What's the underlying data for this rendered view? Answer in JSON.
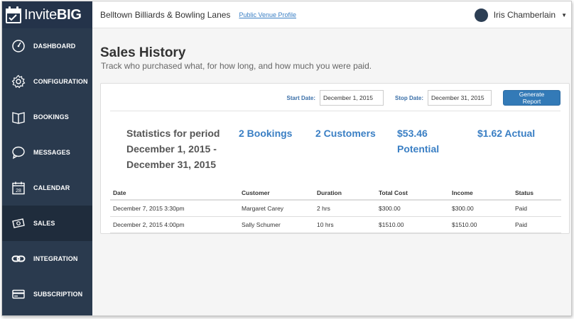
{
  "brand": {
    "name_light": "Invite",
    "name_bold": "BIG"
  },
  "sidebar": {
    "items": [
      {
        "label": "DASHBOARD",
        "icon": "dashboard-gauge-icon"
      },
      {
        "label": "CONFIGURATION",
        "icon": "gear-icon"
      },
      {
        "label": "BOOKINGS",
        "icon": "book-icon"
      },
      {
        "label": "MESSAGES",
        "icon": "speech-bubble-icon"
      },
      {
        "label": "CALENDAR",
        "icon": "calendar-icon"
      },
      {
        "label": "SALES",
        "icon": "money-icon"
      },
      {
        "label": "INTEGRATION",
        "icon": "link-icon"
      },
      {
        "label": "SUBSCRIPTION",
        "icon": "credit-card-icon"
      }
    ],
    "active": "SALES"
  },
  "topbar": {
    "venue_name": "Belltown Billiards & Bowling Lanes",
    "profile_link": "Public Venue Profile",
    "user_name": "Iris Chamberlain"
  },
  "page": {
    "title": "Sales History",
    "subtitle": "Track who purchased what, for how long, and how much you were paid."
  },
  "filters": {
    "start_label": "Start Date:",
    "start_value": "December 1, 2015",
    "stop_label": "Stop Date:",
    "stop_value": "December 31, 2015",
    "button": "Generate Report"
  },
  "stats": {
    "label_line1": "Statistics for period",
    "label_line2": "December 1, 2015 -",
    "label_line3": "December 31, 2015",
    "bookings": "2 Bookings",
    "customers": "2 Customers",
    "potential": "$53.46 Potential",
    "actual": "$1.62 Actual"
  },
  "table": {
    "headers": [
      "Date",
      "Customer",
      "Duration",
      "Total Cost",
      "Income",
      "Status"
    ],
    "rows": [
      [
        "December 7, 2015 3:30pm",
        "Margaret Carey",
        "2 hrs",
        "$300.00",
        "$300.00",
        "Paid"
      ],
      [
        "December 2, 2015 4:00pm",
        "Sally Schumer",
        "10 hrs",
        "$1510.00",
        "$1510.00",
        "Paid"
      ]
    ]
  },
  "colors": {
    "sidebar": "#2a3a4e",
    "accent": "#3a7fc4",
    "button": "#337ab7"
  }
}
